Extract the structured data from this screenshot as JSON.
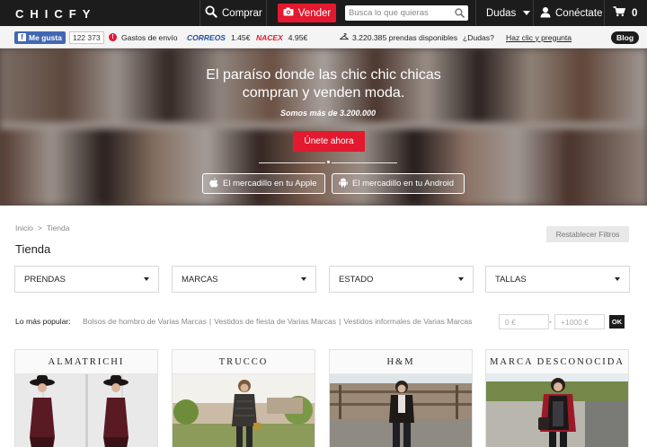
{
  "brand": {
    "logo": "CHICFY"
  },
  "topnav": {
    "buy_label": "Comprar",
    "sell_label": "Vender",
    "search_placeholder": "Busca lo que quieras",
    "help_label": "Dudas",
    "login_label": "Conéctate",
    "cart_count": "0"
  },
  "infobar": {
    "fb_like_label": "Me gusta",
    "fb_like_count": "122 373",
    "shipping_label": "Gastos de envío",
    "carriers": [
      {
        "name": "CORREOS",
        "price": "1.45€",
        "color": "#1f4f9e"
      },
      {
        "name": "NACEX",
        "price": "4.95€",
        "color": "#e3192f"
      }
    ],
    "items_available": "3.220.385 prendas disponibles",
    "questions_label": "¿Dudas?",
    "click_ask_label": "Haz clic y pregunta",
    "blog_label": "Blog"
  },
  "hero": {
    "title_line1": "El paraíso donde las chic chic chicas",
    "title_line2": "compran y venden moda.",
    "subtitle": "Somos más de 3.200.000",
    "join_label": "Únete ahora",
    "apple_label": "El mercadillo en tu Apple",
    "android_label": "El mercadillo en tu Android"
  },
  "breadcrumb": {
    "home": "Inicio",
    "separator": ">",
    "current": "Tienda"
  },
  "reset_filters_label": "Restablecer Filtros",
  "page_title": "Tienda",
  "filters": [
    {
      "label": "PRENDAS"
    },
    {
      "label": "MARCAS"
    },
    {
      "label": "ESTADO"
    },
    {
      "label": "TALLAS"
    }
  ],
  "popular": {
    "label": "Lo más popular:",
    "links": [
      "Bolsos de hombro de Varias Marcas",
      "Vestidos de fiesta de Varias Marcas",
      "Vestidos informales de Varias Marcas"
    ],
    "link_separator": "|"
  },
  "price_filter": {
    "min_placeholder": "0 €",
    "separator": "-",
    "max_placeholder": "+1000 €",
    "ok_label": "OK"
  },
  "brand_cards": [
    {
      "name": "ALMATRICHI"
    },
    {
      "name": "TRUCCO"
    },
    {
      "name": "H&M"
    },
    {
      "name": "MARCA DESCONOCIDA"
    }
  ],
  "colors": {
    "accent": "#e3192f",
    "nav_bg": "#1c1c1c",
    "facebook": "#4267b2"
  }
}
